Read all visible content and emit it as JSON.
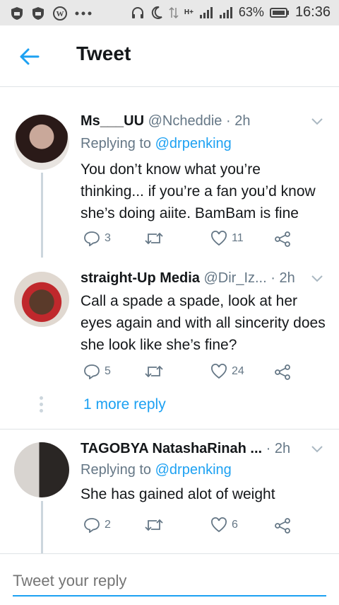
{
  "status_bar": {
    "battery_percent": "63%",
    "time": "16:36",
    "network_label": "H+"
  },
  "header": {
    "title": "Tweet"
  },
  "replies": [
    {
      "name": "Ms___UU",
      "handle": "@Ncheddie",
      "time": "· 2h",
      "replying_prefix": "Replying to",
      "replying_to": "@drpenking",
      "text": "You don’t know what you’re thinking... if you’re a fan you’d know she’s doing aiite. BamBam is fine",
      "reply_count": "3",
      "like_count": "11"
    },
    {
      "name": "straight-Up Media",
      "handle": "@Dir_Iz...",
      "time": "· 2h",
      "text": "Call a spade a spade, look at her eyes again and with all sincerity does she look like she’s fine?",
      "reply_count": "5",
      "like_count": "24",
      "more_replies": "1 more reply"
    },
    {
      "name": "TAGOBYA NatashaRinah ...",
      "time": "· 2h",
      "replying_prefix": "Replying to",
      "replying_to": "@drpenking",
      "text": "She has gained alot of weight",
      "reply_count": "2",
      "like_count": "6"
    }
  ],
  "compose": {
    "placeholder": "Tweet your reply"
  },
  "colors": {
    "accent": "#1da1f2",
    "secondary_text": "#657786",
    "divider": "#dfe3e6"
  }
}
